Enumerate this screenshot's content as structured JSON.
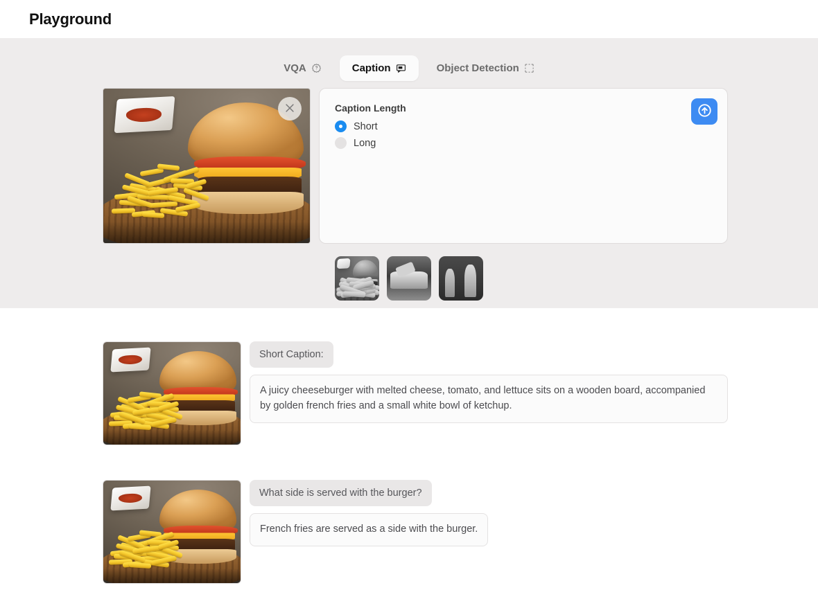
{
  "header": {
    "title": "Playground"
  },
  "tabs": [
    {
      "label": "VQA",
      "icon": "question-badge-icon",
      "active": false
    },
    {
      "label": "Caption",
      "icon": "message-icon",
      "active": true
    },
    {
      "label": "Object Detection",
      "icon": "bounding-box-icon",
      "active": false
    }
  ],
  "workspace": {
    "image_alt": "cheeseburger with french fries on a wooden board",
    "close_icon": "close-icon",
    "settings": {
      "title": "Caption Length",
      "options": [
        {
          "label": "Short",
          "selected": true
        },
        {
          "label": "Long",
          "selected": false
        }
      ],
      "submit_icon": "arrow-up-circle-icon"
    }
  },
  "thumbnails": [
    {
      "alt": "burger and fries thumbnail"
    },
    {
      "alt": "sports car thumbnail"
    },
    {
      "alt": "bottles thumbnail"
    }
  ],
  "results": [
    {
      "prompt": "Short Caption:",
      "response": "A juicy cheeseburger with melted cheese, tomato, and lettuce sits on a wooden board, accompanied by golden french fries and a small white bowl of ketchup.",
      "image_alt": "cheeseburger with french fries on a wooden board"
    },
    {
      "prompt": "What side is served with the burger?",
      "response": "French fries are served as a side with the burger.",
      "image_alt": "cheeseburger with french fries on a wooden board"
    }
  ],
  "colors": {
    "accent": "#3d8bf2",
    "radio_on": "#1a8cf0",
    "panel_bg": "#eeecec",
    "chip_bg": "#e9e7e7"
  }
}
